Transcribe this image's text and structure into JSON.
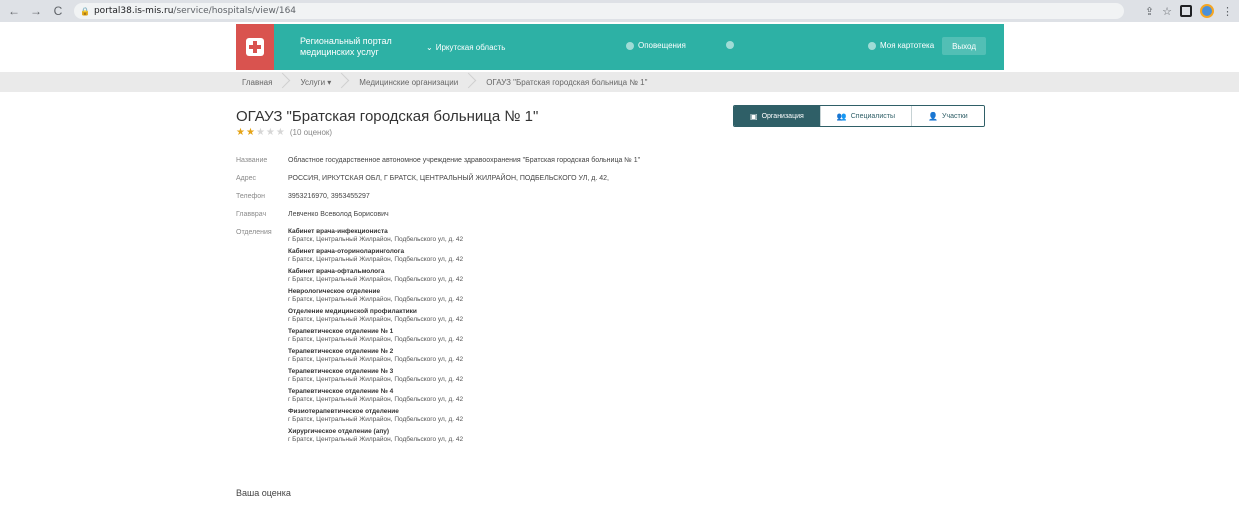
{
  "browser": {
    "url_host": "portal38.is-mis.ru",
    "url_path": "/service/hospitals/view/164",
    "back_icon": "←",
    "forward_icon": "→",
    "reload_icon": "C"
  },
  "header": {
    "portal_title": "Региональный портал медицинских услуг",
    "region": "Иркутская область",
    "notifications": "Оповещения",
    "my_card": "Моя картотека",
    "exit": "Выход",
    "accent_color": "#2db1a5",
    "logo_color": "#d9534f"
  },
  "breadcrumb": [
    "Главная",
    "Услуги ▾",
    "Медицинские организации",
    "ОГАУЗ \"Братская городская больница № 1\""
  ],
  "page": {
    "title": "ОГАУЗ \"Братская городская больница № 1\"",
    "rating_stars": 2,
    "rating_max": 5,
    "votes": "(10 оценок)"
  },
  "tabs": [
    {
      "label": "Организация",
      "icon": "building-icon",
      "active": true
    },
    {
      "label": "Специалисты",
      "icon": "people-icon",
      "active": false
    },
    {
      "label": "Участки",
      "icon": "person-icon",
      "active": false
    }
  ],
  "info": {
    "name_label": "Название",
    "name_value": "Областное государственное автономное учреждение здравоохранения \"Братская городская больница № 1\"",
    "address_label": "Адрес",
    "address_value": "РОССИЯ, ИРКУТСКАЯ ОБЛ, Г БРАТСК, ЦЕНТРАЛЬНЫЙ ЖИЛРАЙОН, ПОДБЕЛЬСКОГО УЛ, д. 42,",
    "phone_label": "Телефон",
    "phone_value": "3953216970, 3953455297",
    "chief_label": "Главврач",
    "chief_value": "Левченко Всеволод Борисович",
    "departments_label": "Отделения"
  },
  "departments": [
    {
      "name": "Кабинет врача-инфекциониста",
      "address": "г Братск, Центральный Жилрайон, Подбельского ул, д. 42"
    },
    {
      "name": "Кабинет врача-оториноларинголога",
      "address": "г Братск, Центральный Жилрайон, Подбельского ул, д. 42"
    },
    {
      "name": "Кабинет врача-офтальмолога",
      "address": "г Братск, Центральный Жилрайон, Подбельского ул, д. 42"
    },
    {
      "name": "Неврологическое отделение",
      "address": "г Братск, Центральный Жилрайон, Подбельского ул, д. 42"
    },
    {
      "name": "Отделение медицинской профилактики",
      "address": "г Братск, Центральный Жилрайон, Подбельского ул, д. 42"
    },
    {
      "name": "Терапевтическое отделение № 1",
      "address": "г Братск, Центральный Жилрайон, Подбельского ул, д. 42"
    },
    {
      "name": "Терапевтическое отделение № 2",
      "address": "г Братск, Центральный Жилрайон, Подбельского ул, д. 42"
    },
    {
      "name": "Терапевтическое отделение № 3",
      "address": "г Братск, Центральный Жилрайон, Подбельского ул, д. 42"
    },
    {
      "name": "Терапевтическое отделение № 4",
      "address": "г Братск, Центральный Жилрайон, Подбельского ул, д. 42"
    },
    {
      "name": "Физиотерапевтическое отделение",
      "address": "г Братск, Центральный Жилрайон, Подбельского ул, д. 42"
    },
    {
      "name": "Хирургическое отделение (апу)",
      "address": "г Братск, Центральный Жилрайон, Подбельского ул, д. 42"
    }
  ],
  "footer": {
    "your_rating": "Ваша оценка"
  }
}
